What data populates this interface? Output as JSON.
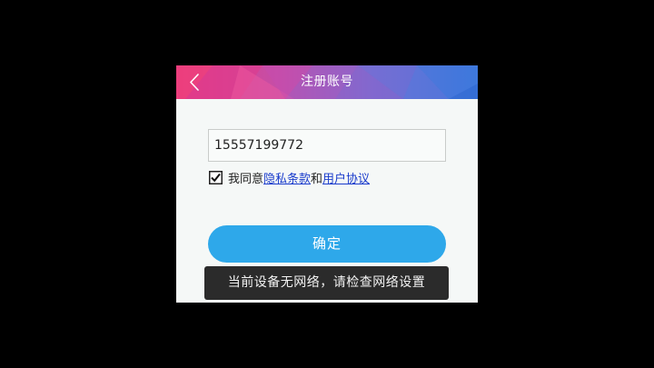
{
  "header": {
    "title": "注册账号",
    "back_icon": "chevron-left-icon"
  },
  "form": {
    "phone_value": "15557199772",
    "agreement": {
      "checked": true,
      "prefix": "我同意",
      "privacy_link": "隐私条款",
      "conjunction": "和",
      "user_agreement_link": "用户协议"
    },
    "confirm_label": "确定"
  },
  "toast": {
    "message": "当前设备无网络，请检查网络设置"
  },
  "colors": {
    "header_pink": "#e8337a",
    "header_blue": "#3a6fd8",
    "button_blue": "#2ea8ea",
    "link_blue": "#1a3ccc",
    "caret_teal": "#19b3a6",
    "toast_bg": "#2b2b2b"
  }
}
